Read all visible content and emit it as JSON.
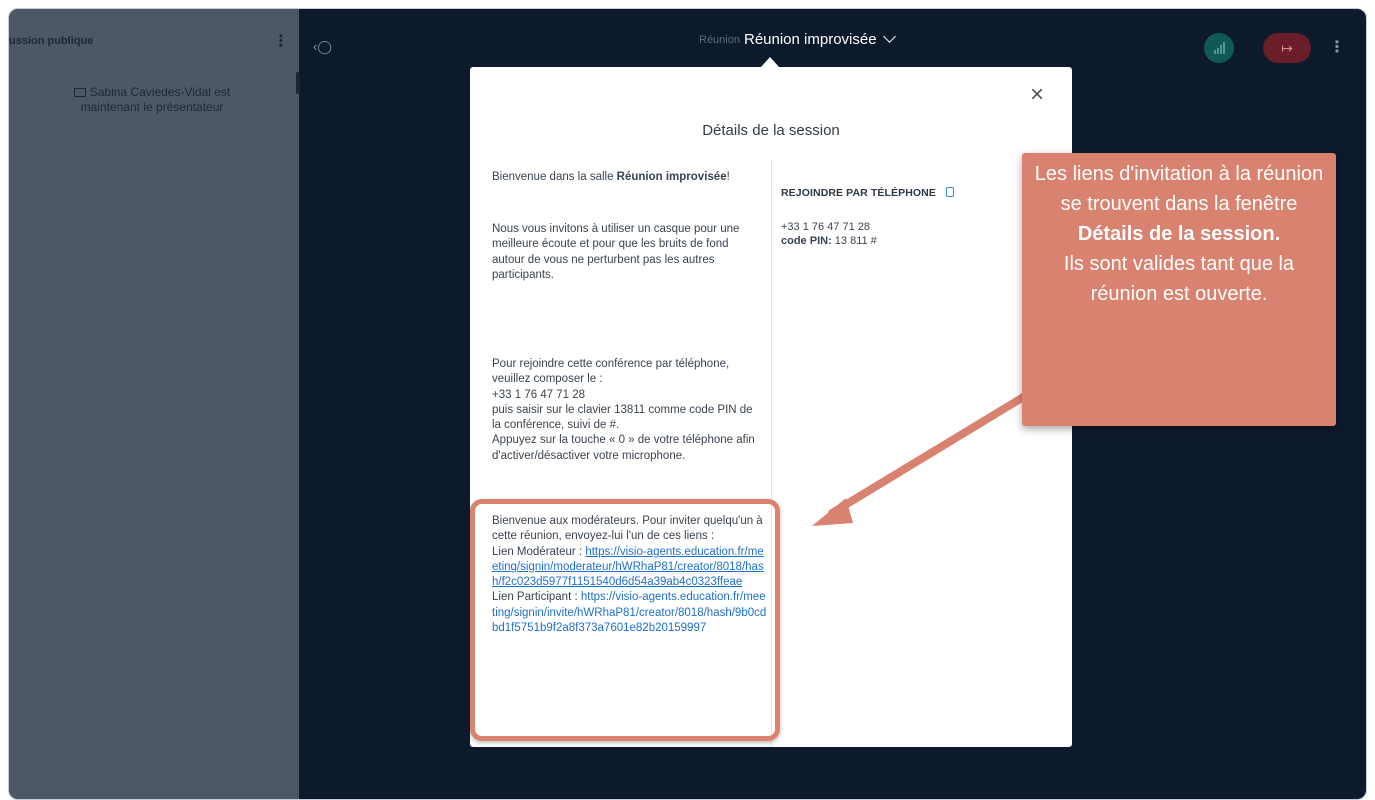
{
  "chat": {
    "header_title": "ussion publique",
    "message": "Sabina Caviedes-Vidal est maintenant le présentateur"
  },
  "topbar": {
    "ghost_title": "Réunion",
    "meeting_title": "Réunion improvisée"
  },
  "modal": {
    "title": "Détails de la session",
    "close_label": "×",
    "welcome_prefix": "Bienvenue dans la salle ",
    "welcome_room": "Réunion improvisée",
    "welcome_suffix": "!",
    "headset_text": "Nous vous invitons à utiliser un casque pour une meilleure écoute et pour que les bruits de fond autour de vous ne perturbent pas les autres participants.",
    "phone_lines": [
      "Pour rejoindre cette conférence par téléphone, veuillez composer le :",
      "+33 1 76 47 71 28",
      "puis saisir sur le clavier 13811 comme code PIN de la conférence, suivi de #.",
      "Appuyez sur la touche « 0 » de votre téléphone afin d'activer/désactiver votre microphone."
    ],
    "moderators_intro": "Bienvenue aux modérateurs. Pour inviter quelqu'un à cette réunion, envoyez-lui l'un de ces liens :",
    "moderator_link_label": "Lien Modérateur : ",
    "moderator_link": "https://visio-agents.education.fr/meeting/signin/moderateur/hWRhaP81/creator/8018/hash/f2c023d5977f1151540d6d54a39ab4c0323ffeae",
    "participant_link_label": "Lien Participant : ",
    "participant_link": "https://visio-agents.education.fr/meeting/signin/invite/hWRhaP81/creator/8018/hash/9b0cdbd1f5751b9f2a8f373a7601e82b20159997",
    "phone_section_title": "REJOINDRE PAR TÉLÉPHONE",
    "phone_number": "+33 1 76 47 71 28",
    "pin_label": "code PIN:",
    "pin_value": "13 811 #"
  },
  "callout": {
    "text_part1": "Les liens d'invitation à la réunion se trouvent dans la fenêtre",
    "text_bold": "Détails de la session.",
    "text_part2": "Ils sont valides tant que la réunion est ouverte."
  },
  "colors": {
    "background": "#0d1a2b",
    "annotation": "#d9826f",
    "link": "#1f6fd0"
  },
  "icons": [
    "user-toggle-icon",
    "chevron-down-icon",
    "connection-bars-icon",
    "leave-icon",
    "kebab-icon",
    "close-icon",
    "copy-icon",
    "screen-share-icon"
  ]
}
